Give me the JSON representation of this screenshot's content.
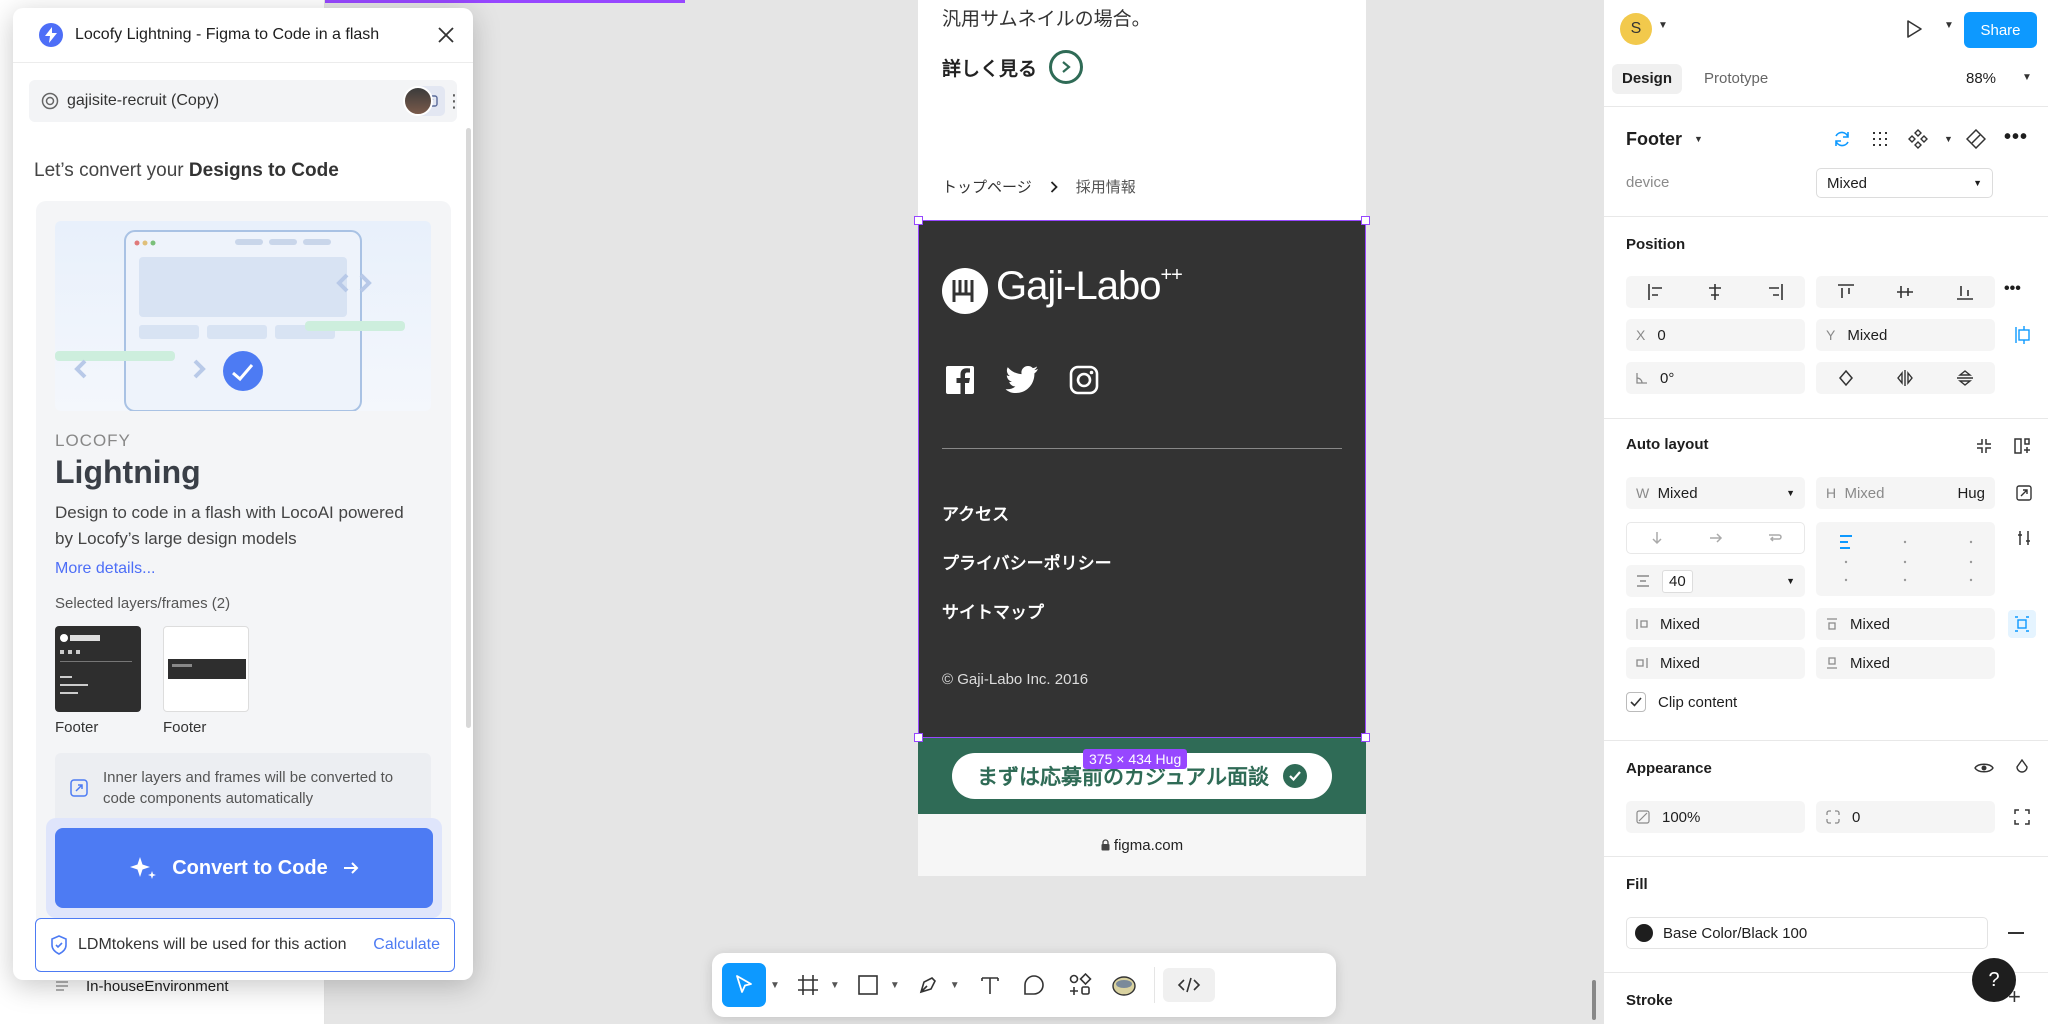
{
  "plugin": {
    "title": "Locofy Lightning - Figma to Code in a flash",
    "project_name": "gajisite-recruit (Copy)",
    "headline_prefix": "Let’s convert your ",
    "headline_bold": "Designs to Code",
    "brand": "LOCOFY",
    "product": "Lightning",
    "description": "Design to code in a flash with LocoAI powered by Locofy’s large design models",
    "more_link": "More details...",
    "selected_label": "Selected layers/frames (2)",
    "thumbs": [
      {
        "label": "Footer"
      },
      {
        "label": "Footer"
      }
    ],
    "info_text": "Inner layers and frames will be converted to code components automatically",
    "convert_button": "Convert to Code",
    "ldm_text": "LDMtokens will be used for this action",
    "calculate": "Calculate"
  },
  "layers": {
    "visible_item": "In-houseEnvironment"
  },
  "canvas": {
    "top_text": "汎用サムネイルの場合。",
    "detail_link": "詳しく見る",
    "breadcrumb": [
      "トップページ",
      "採用情報"
    ],
    "footer": {
      "logo_text": "Gaji-Labo",
      "logo_sup": "++",
      "links": [
        "アクセス",
        "プライバシーポリシー",
        "サイトマップ"
      ],
      "copyright": "© Gaji-Labo Inc. 2016"
    },
    "size_badge": "375 × 434 Hug",
    "cta": "まずは応募前のカジュアル面談",
    "url": "figma.com"
  },
  "toolbar": {
    "tools": [
      "move",
      "frame",
      "rectangle",
      "pen",
      "text",
      "comment",
      "components",
      "mascot",
      "dev-mode"
    ]
  },
  "right": {
    "avatar_initial": "S",
    "share": "Share",
    "tabs": {
      "design": "Design",
      "prototype": "Prototype"
    },
    "zoom": "88%",
    "component_name": "Footer",
    "device_label": "device",
    "device_value": "Mixed",
    "position": {
      "title": "Position",
      "x_label": "X",
      "x": "0",
      "y_label": "Y",
      "y": "Mixed",
      "rotation": "0°"
    },
    "auto_layout": {
      "title": "Auto layout",
      "w_label": "W",
      "w": "Mixed",
      "h_label": "H",
      "h": "Mixed",
      "h_mode": "Hug",
      "gap": "40",
      "pad_left": "Mixed",
      "pad_top": "Mixed",
      "pad_right": "Mixed",
      "pad_bottom": "Mixed",
      "clip": "Clip content"
    },
    "appearance": {
      "title": "Appearance",
      "opacity": "100%",
      "radius": "0"
    },
    "fill": {
      "title": "Fill",
      "value": "Base Color/Black 100",
      "color": "#1e1e1e"
    },
    "stroke": {
      "title": "Stroke"
    },
    "help": "?"
  },
  "colors": {
    "accent": "#0d99ff",
    "selection": "#9747ff",
    "locofy": "#4d7bf3",
    "brand_green": "#2f6b56",
    "footer_bg": "#333333"
  }
}
